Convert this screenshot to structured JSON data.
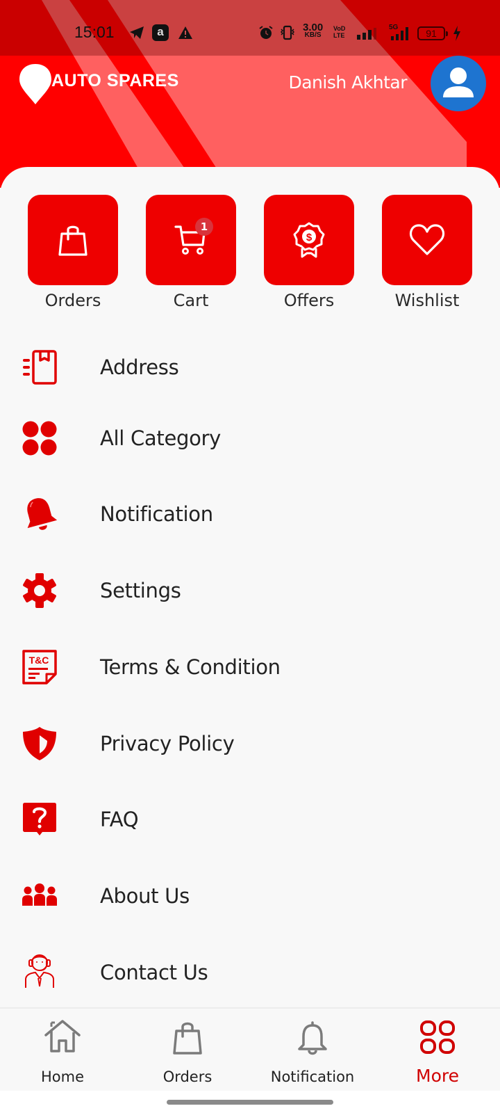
{
  "status_bar": {
    "time": "15:01",
    "left_icons": [
      "telegram-icon",
      "amazon-app-icon",
      "warning-icon"
    ],
    "speed_value": "3.00",
    "speed_unit": "KB/S",
    "volte_top": "VoD",
    "volte_bottom": "LTE",
    "network_label": "5G",
    "battery_level": "91",
    "charging": true
  },
  "header": {
    "brand_name": "AUTO SPARES",
    "user_name": "Danish Akhtar",
    "colors": {
      "primary": "#ff0000",
      "stripe": "#ff6060",
      "avatar_bg": "#1e74d0"
    }
  },
  "quick_actions": [
    {
      "label": "Orders",
      "icon": "shopping-bag-icon"
    },
    {
      "label": "Cart",
      "icon": "cart-icon",
      "badge": "1"
    },
    {
      "label": "Offers",
      "icon": "offer-badge-icon"
    },
    {
      "label": "Wishlist",
      "icon": "heart-icon"
    }
  ],
  "menu": [
    {
      "label": "Address",
      "icon": "address-icon"
    },
    {
      "label": "All Category",
      "icon": "category-icon"
    },
    {
      "label": "Notification",
      "icon": "bell-icon"
    },
    {
      "label": "Settings",
      "icon": "gear-icon"
    },
    {
      "label": "Terms & Condition",
      "icon": "terms-icon",
      "icon_text": "T&C"
    },
    {
      "label": "Privacy Policy",
      "icon": "shield-icon"
    },
    {
      "label": "FAQ",
      "icon": "faq-icon"
    },
    {
      "label": "About Us",
      "icon": "team-icon"
    },
    {
      "label": "Contact Us",
      "icon": "support-agent-icon"
    }
  ],
  "bottom_nav": {
    "items": [
      {
        "label": "Home",
        "icon": "home-icon"
      },
      {
        "label": "Orders",
        "icon": "shopping-bag-icon"
      },
      {
        "label": "Notification",
        "icon": "bell-icon"
      },
      {
        "label": "More",
        "icon": "grid-icon",
        "active": true
      }
    ],
    "active_color": "#d00000"
  }
}
